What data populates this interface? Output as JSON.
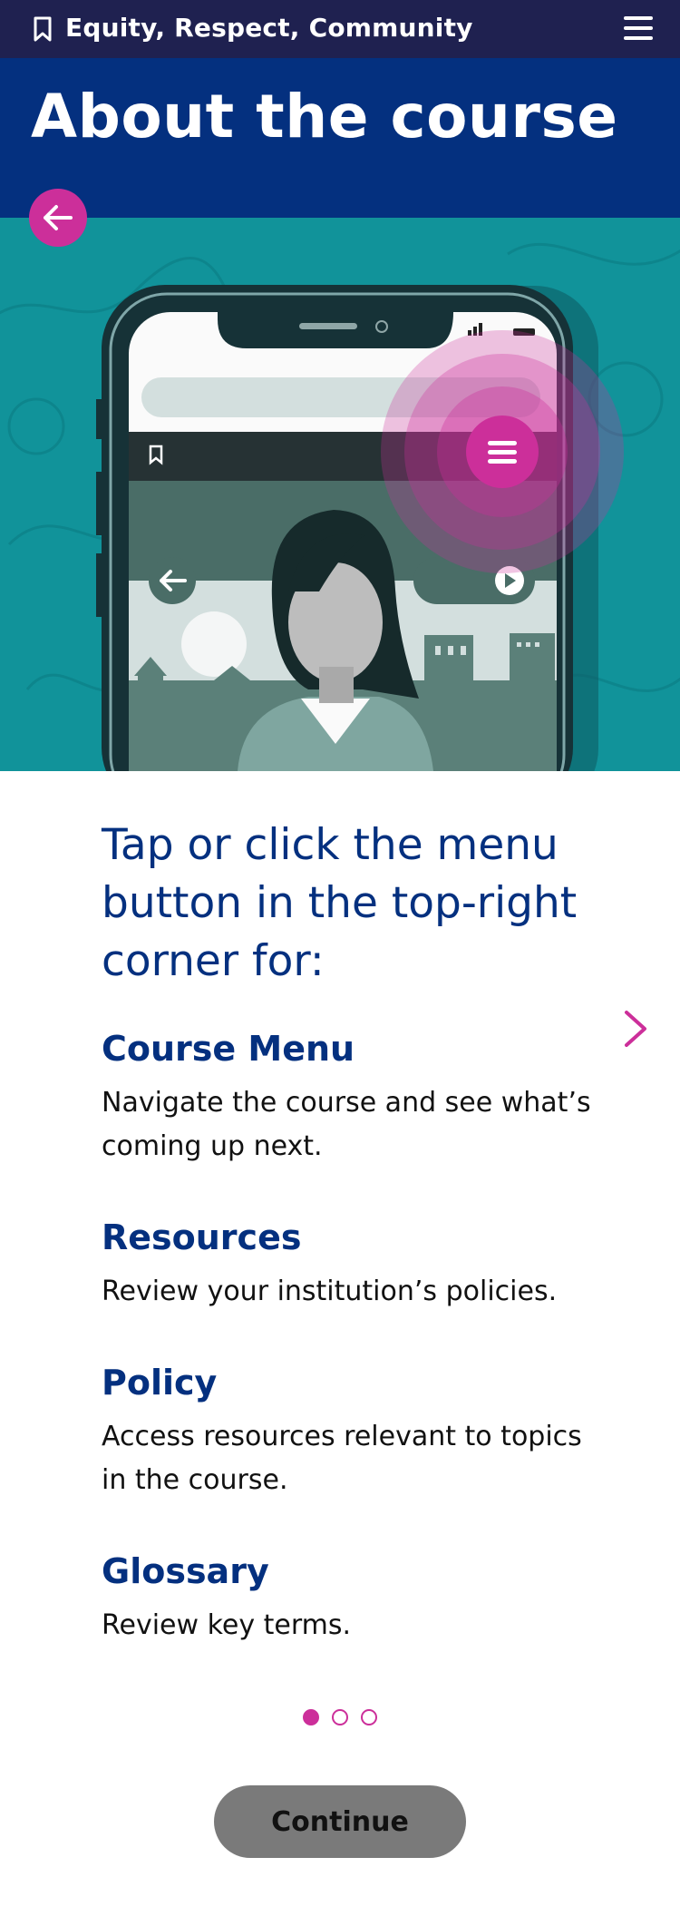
{
  "header": {
    "title": "Equity, Respect, Community",
    "bookmark_icon": "bookmark-icon",
    "menu_icon": "hamburger-menu-icon"
  },
  "hero": {
    "title": "About the course"
  },
  "illustration": {
    "background": "#11939a",
    "subject": "phone-with-woman-illustration"
  },
  "content": {
    "lead": "Tap or click the menu button in the top-right corner for:",
    "sections": [
      {
        "title": "Course Menu",
        "text": "Navigate the course and see what’s coming up next."
      },
      {
        "title": "Resources",
        "text": "Review your institution’s policies."
      },
      {
        "title": "Policy",
        "text": "Access resources relevant to topics in the course."
      },
      {
        "title": "Glossary",
        "text": "Review key terms."
      }
    ]
  },
  "pagination": {
    "current": 1,
    "total": 3
  },
  "actions": {
    "continue_label": "Continue"
  },
  "colors": {
    "topbar": "#1f2150",
    "hero": "#04307f",
    "accent": "#cc2f9a",
    "heading": "#04307f"
  }
}
